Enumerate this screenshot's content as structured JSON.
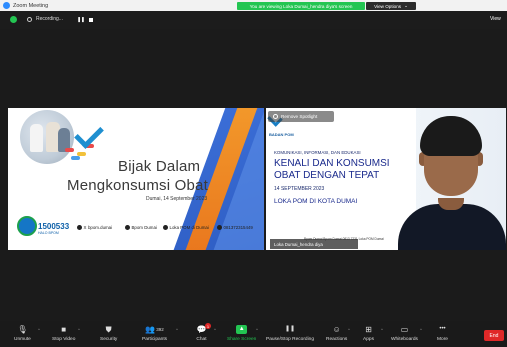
{
  "window": {
    "title": "Zoom Meeting"
  },
  "banner": {
    "viewing": "You are viewing Loka Dumai_hendra diya's screen",
    "view_options": "View Options",
    "view_options_caret": "⌄"
  },
  "recording": {
    "label": "Recording...",
    "pause_glyph": "❚❚"
  },
  "top_right": {
    "view_label": "View"
  },
  "slide": {
    "line1": "Bijak Dalam",
    "line2": "Mengkonsumsi Obat",
    "date": "Dumai, 14 September 2023",
    "hotline_number": "1500533",
    "hotline_sub": "HALO BPOM",
    "socials": [
      {
        "glyph": "◎",
        "label": "X"
      },
      {
        "glyph": "",
        "label": "bpom.dumai"
      },
      {
        "glyph": "",
        "label": "Bpom Dumai"
      },
      {
        "glyph": "▶",
        "label": "Loka POM di Dumai"
      },
      {
        "glyph": "",
        "label": "081372315449"
      }
    ]
  },
  "camera": {
    "spotlight": "Remove Spotlight",
    "org": "BADAN POM",
    "kie": "KOMUNIKASI, INFORMASI, DAN EDUKASI",
    "title1": "KENALI DAN KONSUMSI",
    "title2": "OBAT DENGAN TEPAT",
    "date": "14 SEPTEMBER 2023",
    "loka": "LOKA POM DI KOTA DUMAI",
    "socials": "Bpom Dumai  Bpom Dumai  0813 7231  Loka POM Dumai",
    "name": "Loka Dumai_hendra diya"
  },
  "toolbar": {
    "items": [
      {
        "key": "unmute",
        "label": "Unmute",
        "glyph": "🎙"
      },
      {
        "key": "stop_video",
        "label": "Stop Video",
        "glyph": "■"
      },
      {
        "key": "security",
        "label": "Security",
        "glyph": "⛊"
      },
      {
        "key": "participants",
        "label": "Participants",
        "glyph": "👥",
        "count": "392"
      },
      {
        "key": "chat",
        "label": "Chat",
        "glyph": "💬",
        "badge": "1"
      },
      {
        "key": "share",
        "label": "Share Screen",
        "glyph": "▲"
      },
      {
        "key": "record",
        "label": "Pause/Stop Recording",
        "glyph": "❚❚"
      },
      {
        "key": "reactions",
        "label": "Reactions",
        "glyph": "☺"
      },
      {
        "key": "apps",
        "label": "Apps",
        "glyph": "⊞"
      },
      {
        "key": "whiteboards",
        "label": "Whiteboards",
        "glyph": "▭"
      },
      {
        "key": "more",
        "label": "More",
        "glyph": "•••"
      }
    ],
    "end_label": "End",
    "caret": "^"
  }
}
